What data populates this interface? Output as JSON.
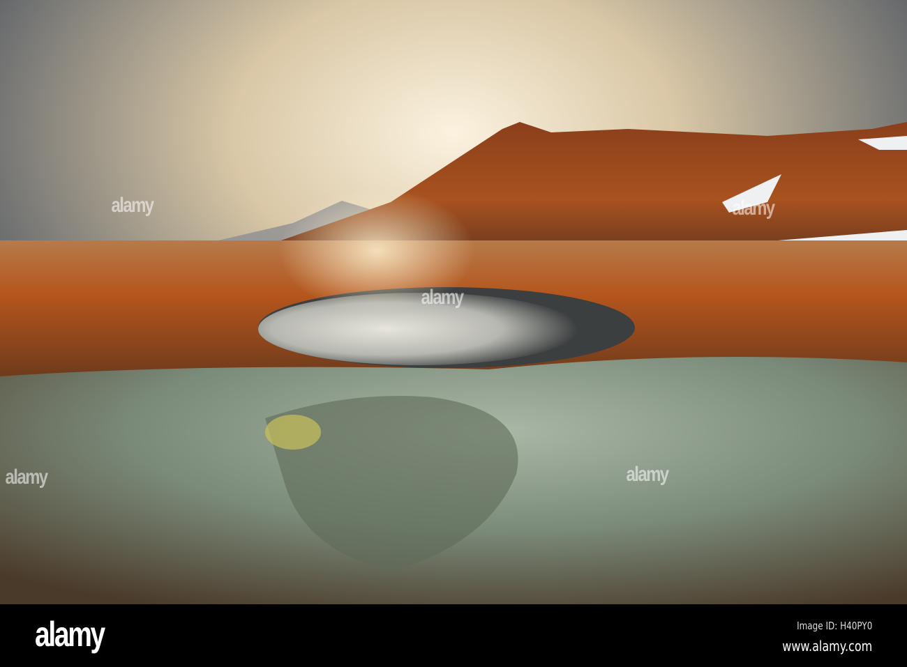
{
  "photo": {
    "subject": "geothermal mud pot with steam, orange mountain and dramatic sky",
    "watermark_text": "alamy"
  },
  "footer": {
    "logo": "alamy",
    "image_id": "Image ID: H40PY0",
    "url": "www.alamy.com"
  },
  "colors": {
    "sky_bright": "#f3e6cc",
    "sky_dark": "#3c4650",
    "mountain": "#9a4a1e",
    "ground": "#b0561f",
    "foreground": "#7d8a78"
  }
}
